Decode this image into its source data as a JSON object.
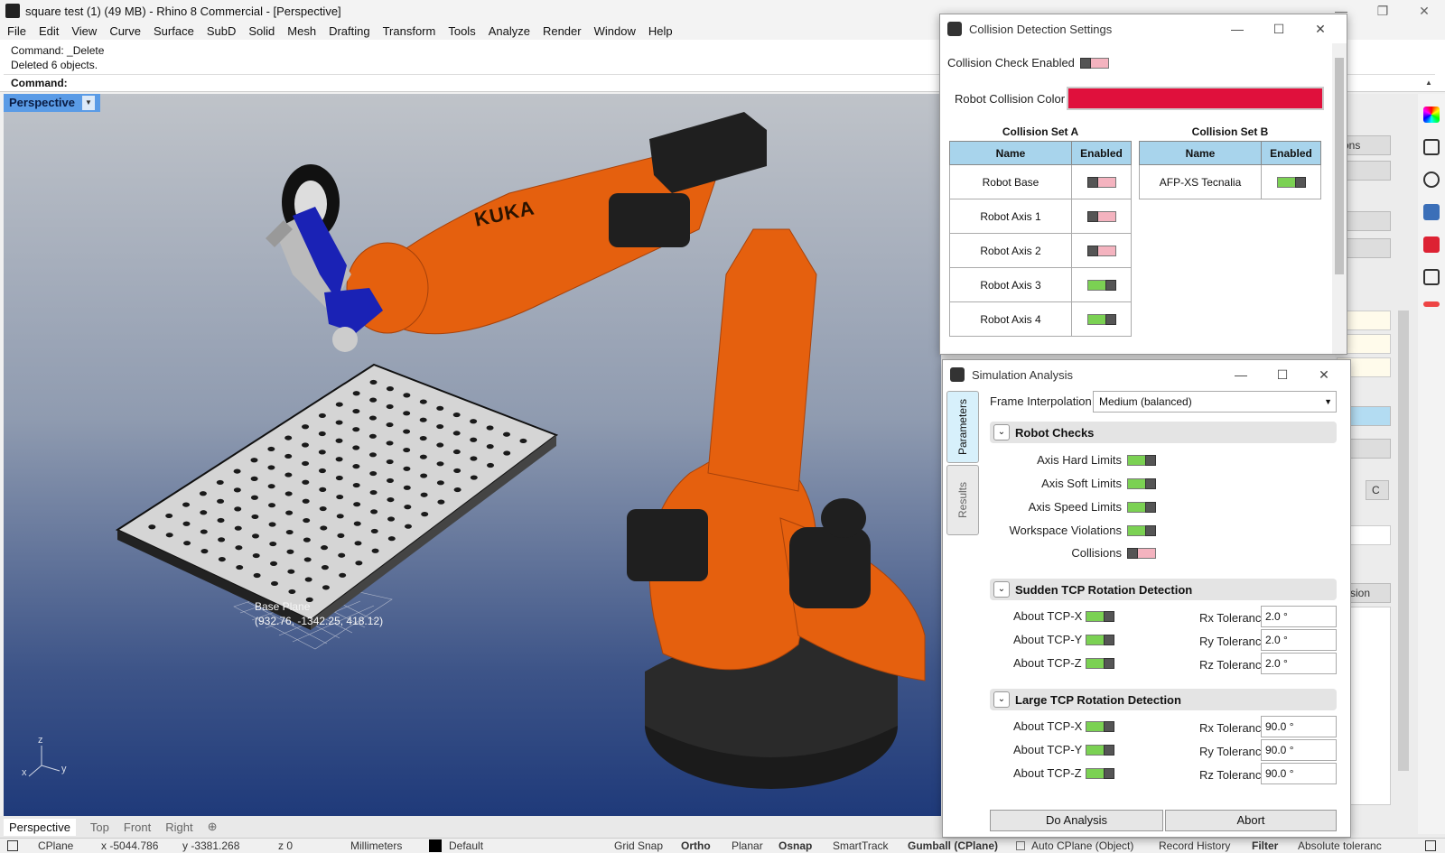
{
  "window": {
    "title": "square test (1) (49 MB) - Rhino 8 Commercial - [Perspective]",
    "controls": [
      "—",
      "❐",
      "✕"
    ]
  },
  "menu": [
    "File",
    "Edit",
    "View",
    "Curve",
    "Surface",
    "SubD",
    "Solid",
    "Mesh",
    "Drafting",
    "Transform",
    "Tools",
    "Analyze",
    "Render",
    "Window",
    "Help"
  ],
  "command": {
    "history": [
      "Command: _Delete",
      "Deleted 6 objects."
    ],
    "prompt": "Command:"
  },
  "viewport": {
    "active_tab": "Perspective",
    "robot_brand": "KUKA",
    "base_plane_label": "Base Plane",
    "base_plane_coords": "(932.76, -1342.25, 418.12)",
    "axis_labels": {
      "z": "z",
      "x": "x",
      "y": "y"
    },
    "colors": {
      "robot": "#e5600e",
      "robot_dark": "#1e1e1e",
      "table": "#d6d6d6"
    }
  },
  "viewport_tabs": [
    "Perspective",
    "Top",
    "Front",
    "Right"
  ],
  "statusbar": {
    "cplane": "CPlane",
    "x": "x -5044.786",
    "y": "y -3381.268",
    "z": "z 0",
    "units": "Millimeters",
    "layer": "Default",
    "toggles": [
      "Grid Snap",
      "Ortho",
      "Planar",
      "Osnap",
      "SmartTrack",
      "Gumball (CPlane)",
      "Auto CPlane (Object)",
      "Record History",
      "Filter",
      "Absolute toleranc"
    ]
  },
  "collision_dialog": {
    "title": "Collision Detection Settings",
    "check_enabled_label": "Collision Check Enabled",
    "check_enabled": false,
    "color_label": "Robot Collision Color",
    "color": "#e0103c",
    "set_a": {
      "title": "Collision Set A",
      "headers": [
        "Name",
        "Enabled"
      ],
      "rows": [
        {
          "name": "Robot Base",
          "enabled": false
        },
        {
          "name": "Robot Axis 1",
          "enabled": false
        },
        {
          "name": "Robot Axis 2",
          "enabled": false
        },
        {
          "name": "Robot Axis 3",
          "enabled": true
        },
        {
          "name": "Robot Axis 4",
          "enabled": true
        }
      ]
    },
    "set_b": {
      "title": "Collision Set B",
      "headers": [
        "Name",
        "Enabled"
      ],
      "rows": [
        {
          "name": "AFP-XS Tecnalia",
          "enabled": true
        }
      ]
    }
  },
  "sim_dialog": {
    "title": "Simulation Analysis",
    "side_tabs": [
      "Parameters",
      "Results"
    ],
    "frame_interp_label": "Frame Interpolation",
    "frame_interp_value": "Medium (balanced)",
    "robot_checks": {
      "title": "Robot Checks",
      "items": [
        {
          "label": "Axis Hard Limits",
          "enabled": true
        },
        {
          "label": "Axis Soft Limits",
          "enabled": true
        },
        {
          "label": "Axis Speed Limits",
          "enabled": true
        },
        {
          "label": "Workspace Violations",
          "enabled": true
        },
        {
          "label": "Collisions",
          "enabled": false
        }
      ]
    },
    "sudden": {
      "title": "Sudden TCP Rotation Detection",
      "rows": [
        {
          "axis": "About TCP-X",
          "enabled": true,
          "tol_label": "Rx Tolerance",
          "tol": "2.0 °"
        },
        {
          "axis": "About TCP-Y",
          "enabled": true,
          "tol_label": "Ry Tolerance",
          "tol": "2.0 °"
        },
        {
          "axis": "About TCP-Z",
          "enabled": true,
          "tol_label": "Rz Tolerance",
          "tol": "2.0 °"
        }
      ]
    },
    "large": {
      "title": "Large TCP Rotation Detection",
      "rows": [
        {
          "axis": "About TCP-X",
          "enabled": true,
          "tol_label": "Rx Tolerance",
          "tol": "90.0 °"
        },
        {
          "axis": "About TCP-Y",
          "enabled": true,
          "tol_label": "Ry Tolerance",
          "tol": "90.0 °"
        },
        {
          "axis": "About TCP-Z",
          "enabled": true,
          "tol_label": "Rz Tolerance",
          "tol": "90.0 °"
        }
      ]
    },
    "do_analysis": "Do Analysis",
    "abort": "Abort"
  },
  "right_panel": {
    "partial_labels": [
      "ons",
      "C",
      "x",
      "llision"
    ]
  }
}
